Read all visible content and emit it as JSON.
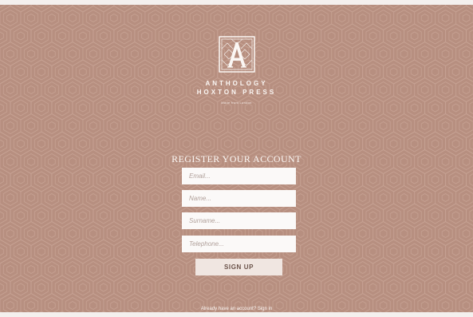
{
  "brand": {
    "logo_icon": "anthology-a-monogram-icon",
    "name_line1": "ANTHOLOGY",
    "name_line2": "HOXTON PRESS",
    "tagline": "Made from London"
  },
  "form": {
    "title": "REGISTER YOUR ACCOUNT",
    "email_placeholder": "Email...",
    "name_placeholder": "Name...",
    "surname_placeholder": "Surname...",
    "telephone_placeholder": "Telephone...",
    "submit_label": "SIGN UP"
  },
  "footer": {
    "prompt": "Already have an account?",
    "signin_label": "Sign in"
  },
  "colors": {
    "background": "#b78f80",
    "pattern_line": "#c9a596",
    "text_light": "#fbf7f4",
    "field_bg": "#fbf9f8",
    "button_bg": "#f0e6e1",
    "button_text": "#6b534a"
  }
}
